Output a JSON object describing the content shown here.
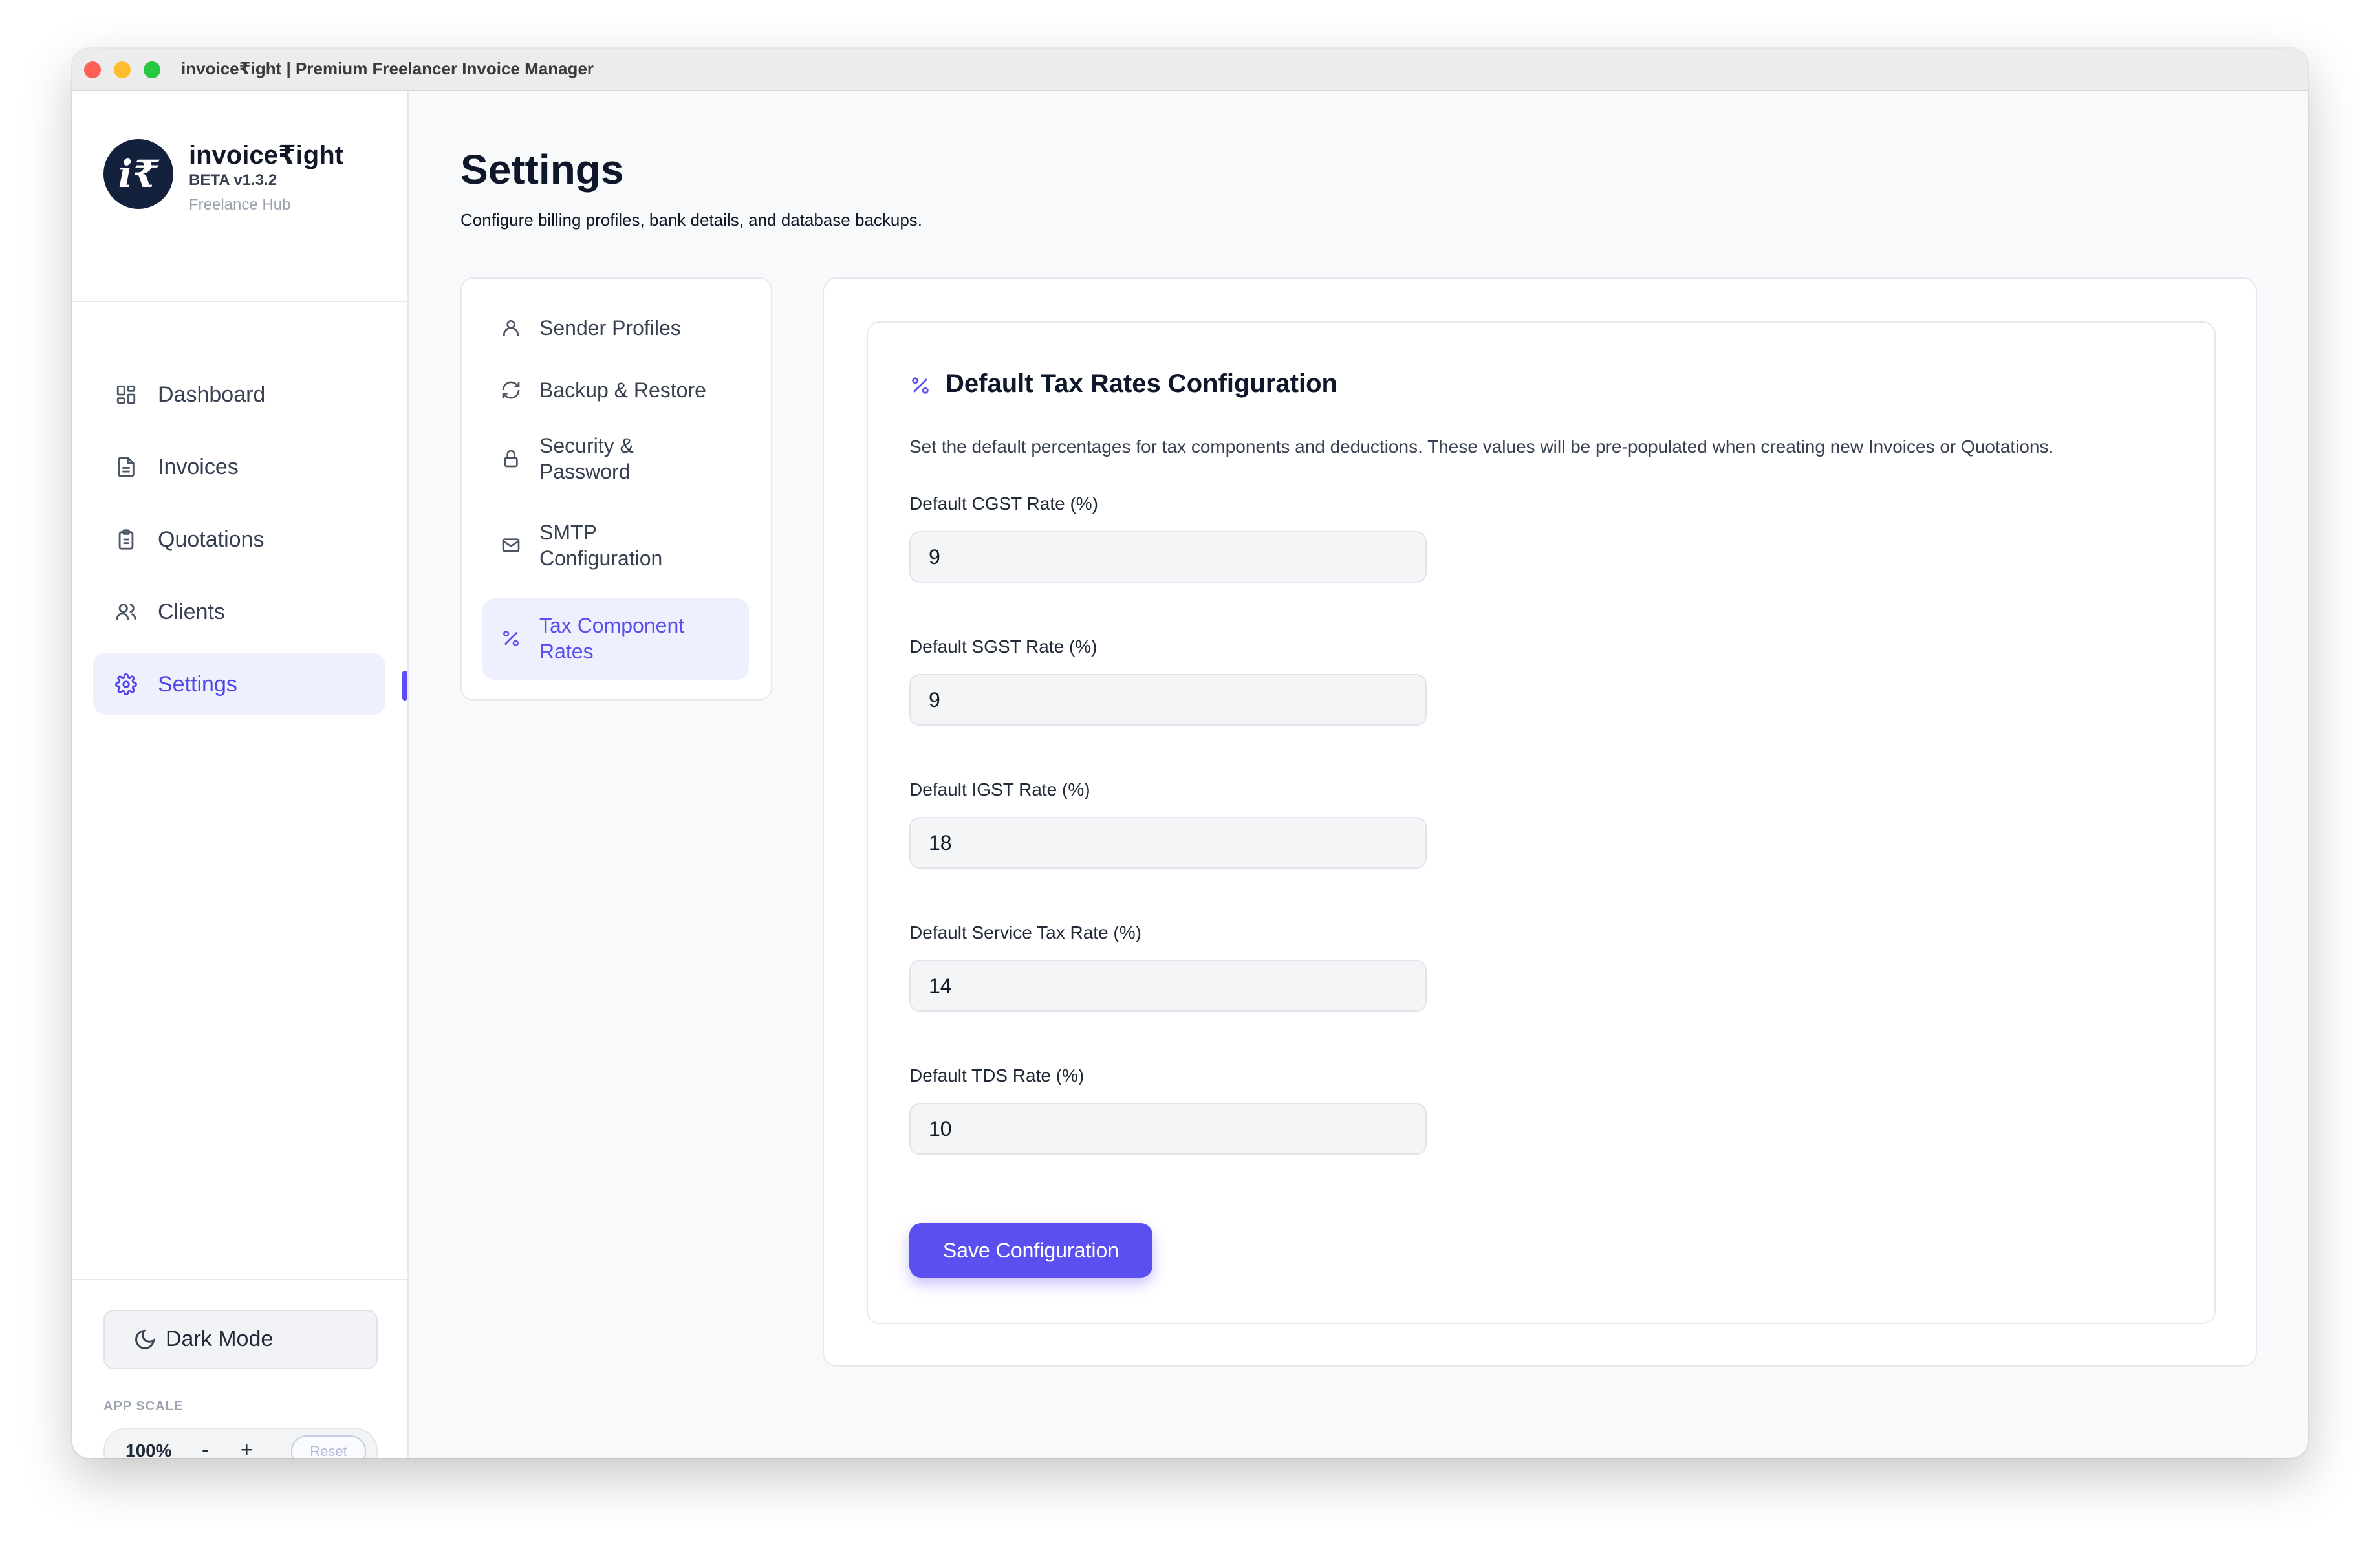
{
  "window": {
    "title": "invoice₹ight | Premium Freelancer Invoice Manager"
  },
  "brand": {
    "name": "invoice₹ight",
    "version": "BETA v1.3.2",
    "tagline": "Freelance Hub",
    "logo_text": "i₹"
  },
  "sidebar": {
    "items": [
      {
        "label": "Dashboard",
        "icon": "dashboard-icon"
      },
      {
        "label": "Invoices",
        "icon": "document-icon"
      },
      {
        "label": "Quotations",
        "icon": "clipboard-icon"
      },
      {
        "label": "Clients",
        "icon": "users-icon"
      },
      {
        "label": "Settings",
        "icon": "gear-icon",
        "active": true
      }
    ],
    "dark_mode_label": "Dark Mode",
    "scale_title": "APP SCALE",
    "scale_value": "100%",
    "scale_minus": "-",
    "scale_plus": "+",
    "scale_reset": "Reset"
  },
  "page": {
    "title": "Settings",
    "subtitle": "Configure billing profiles, bank details, and database backups."
  },
  "subnav": {
    "items": [
      {
        "label": "Sender Profiles",
        "icon": "user-icon"
      },
      {
        "label": "Backup & Restore",
        "icon": "refresh-icon"
      },
      {
        "label": "Security & Password",
        "icon": "lock-icon"
      },
      {
        "label": "SMTP Configuration",
        "icon": "mail-icon"
      },
      {
        "label": "Tax Component Rates",
        "icon": "percent-icon",
        "active": true
      }
    ]
  },
  "tax": {
    "title": "Default Tax Rates Configuration",
    "description": "Set the default percentages for tax components and deductions. These values will be pre-populated when creating new Invoices or Quotations.",
    "fields": [
      {
        "label": "Default CGST Rate (%)",
        "value": "9"
      },
      {
        "label": "Default SGST Rate (%)",
        "value": "9"
      },
      {
        "label": "Default IGST Rate (%)",
        "value": "18"
      },
      {
        "label": "Default Service Tax Rate (%)",
        "value": "14"
      },
      {
        "label": "Default TDS Rate (%)",
        "value": "10"
      }
    ],
    "save_label": "Save Configuration"
  },
  "colors": {
    "accent": "#5b4ff0",
    "accent_soft": "#eef0fd",
    "sidebar_bg": "#ffffff",
    "page_bg": "#f8f9fb"
  }
}
